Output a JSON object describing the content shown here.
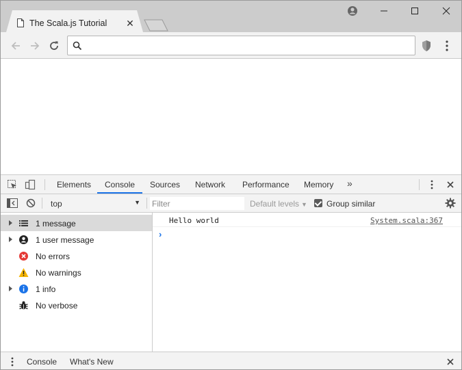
{
  "browser": {
    "tab_title": "The Scala.js Tutorial",
    "tab_close": "✕",
    "icons": {
      "page": "page-icon",
      "profile": "profile-icon",
      "minimize": "minimize-icon",
      "maximize": "maximize-icon",
      "close": "close-icon",
      "back": "back-arrow-icon",
      "forward": "forward-arrow-icon",
      "reload": "reload-icon",
      "search": "search-icon",
      "shield": "shield-icon",
      "menu": "kebab-menu-icon"
    },
    "omnibox_value": ""
  },
  "devtools": {
    "tabs": [
      {
        "label": "Elements"
      },
      {
        "label": "Console",
        "active": true
      },
      {
        "label": "Sources"
      },
      {
        "label": "Network"
      },
      {
        "label": "Performance"
      },
      {
        "label": "Memory"
      }
    ],
    "more_tabs": "»",
    "accent_color": "#1a73e8",
    "console_toolbar": {
      "context": "top",
      "filter_placeholder": "Filter",
      "levels_label": "Default levels",
      "group_similar_label": "Group similar",
      "group_similar_checked": true
    },
    "sidebar": {
      "items": [
        {
          "label": "1 message",
          "icon": "list-icon",
          "expandable": true,
          "selected": true
        },
        {
          "label": "1 user message",
          "icon": "user-icon",
          "expandable": true
        },
        {
          "label": "No errors",
          "icon": "error-icon",
          "expandable": false,
          "color": "#e53935"
        },
        {
          "label": "No warnings",
          "icon": "warning-icon",
          "expandable": false,
          "color": "#f4b400"
        },
        {
          "label": "1 info",
          "icon": "info-icon",
          "expandable": true,
          "color": "#1a73e8"
        },
        {
          "label": "No verbose",
          "icon": "bug-icon",
          "expandable": false
        }
      ]
    },
    "messages": [
      {
        "text": "Hello world",
        "source": "System.scala:367"
      }
    ],
    "prompt": "›",
    "drawer": {
      "tabs": [
        {
          "label": "Console",
          "active": true
        },
        {
          "label": "What's New"
        }
      ]
    }
  }
}
